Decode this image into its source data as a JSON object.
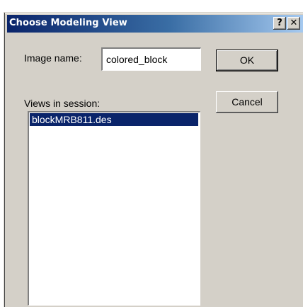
{
  "window": {
    "title": "Choose Modeling View",
    "help_glyph": "?",
    "close_glyph": "✕"
  },
  "form": {
    "image_name_label": "Image name:",
    "image_name_value": "colored_block",
    "views_label": "Views in session:",
    "views": [
      "blockMRB811.des"
    ],
    "selected_view_index": 0
  },
  "buttons": {
    "ok_label": "OK",
    "cancel_label": "Cancel"
  },
  "colors": {
    "title_gradient_start": "#0a246a",
    "title_gradient_end": "#a6caf0",
    "face": "#d4d0c8",
    "selection": "#0a246a"
  }
}
